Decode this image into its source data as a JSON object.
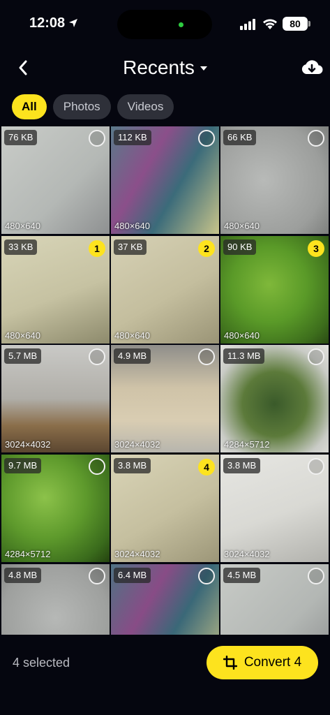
{
  "status": {
    "time": "12:08",
    "battery": "80"
  },
  "nav": {
    "title": "Recents"
  },
  "tabs": [
    {
      "label": "All",
      "active": true
    },
    {
      "label": "Photos",
      "active": false
    },
    {
      "label": "Videos",
      "active": false
    }
  ],
  "grid": [
    {
      "size": "76 KB",
      "dims": "480×640",
      "selection": ""
    },
    {
      "size": "112 KB",
      "dims": "480×640",
      "selection": ""
    },
    {
      "size": "66 KB",
      "dims": "480×640",
      "selection": ""
    },
    {
      "size": "33 KB",
      "dims": "480×640",
      "selection": "1"
    },
    {
      "size": "37 KB",
      "dims": "480×640",
      "selection": "2"
    },
    {
      "size": "90 KB",
      "dims": "480×640",
      "selection": "3"
    },
    {
      "size": "5.7 MB",
      "dims": "3024×4032",
      "selection": ""
    },
    {
      "size": "4.9 MB",
      "dims": "3024×4032",
      "selection": ""
    },
    {
      "size": "11.3 MB",
      "dims": "4284×5712",
      "selection": ""
    },
    {
      "size": "9.7 MB",
      "dims": "4284×5712",
      "selection": ""
    },
    {
      "size": "3.8 MB",
      "dims": "3024×4032",
      "selection": "4"
    },
    {
      "size": "3.8 MB",
      "dims": "3024×4032",
      "selection": ""
    },
    {
      "size": "4.8 MB",
      "dims": "",
      "selection": ""
    },
    {
      "size": "6.4 MB",
      "dims": "",
      "selection": ""
    },
    {
      "size": "4.5 MB",
      "dims": "",
      "selection": ""
    }
  ],
  "bottom": {
    "selected_label": "4 selected",
    "convert_label": "Convert 4"
  },
  "colors": {
    "accent": "#fde31e",
    "background": "#05060f",
    "tab_inactive": "#2e3039"
  },
  "icons": [
    "location-arrow-icon",
    "signal-icon",
    "wifi-icon",
    "battery-icon",
    "back-chevron-icon",
    "dropdown-caret-icon",
    "cloud-download-icon",
    "crop-icon"
  ]
}
